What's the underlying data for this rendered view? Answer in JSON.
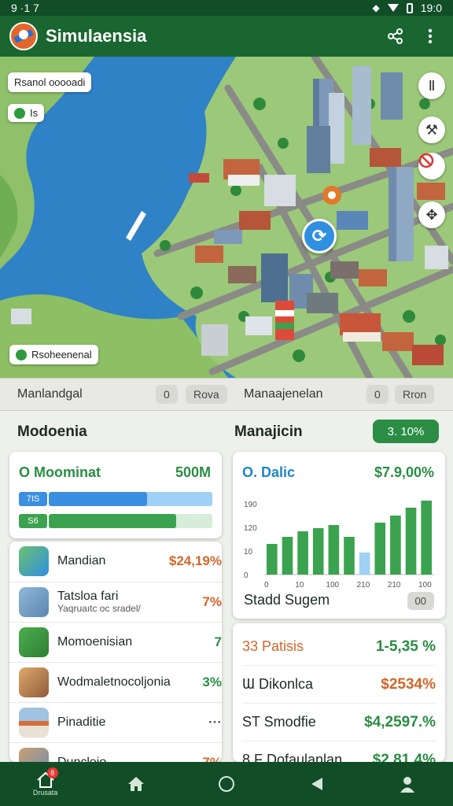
{
  "status_bar": {
    "time_left": "9 ·1 7",
    "time_right": "19:0"
  },
  "app": {
    "title": "Simulaensia"
  },
  "map": {
    "chip_top": "Rsanol ooooadi",
    "chip_small": "Is",
    "chip_bottom": "Rsoheenenal"
  },
  "toolbar": {
    "left_label": "Manlandgal",
    "left_pill_1": "0",
    "left_pill_2": "Rova",
    "right_label": "Manaajenelan",
    "right_pill_1": "0",
    "right_pill_2": "Rron"
  },
  "left_section": {
    "title": "Modoenia"
  },
  "right_section": {
    "title": "Manajicin",
    "badge": "3. 10%"
  },
  "metric_card": {
    "title": "O Moominat",
    "value": "500M",
    "bars": [
      {
        "tag": "7IS",
        "fill": 0.6,
        "color": "#3b8fe0",
        "rest_color": "#9fd0f5"
      },
      {
        "tag": "S6",
        "fill": 0.78,
        "color": "#3ba34f",
        "rest_color": "#d7ecd9"
      }
    ]
  },
  "list_items": [
    {
      "label": "Mandian",
      "sub": "",
      "value": "$24,19%",
      "value_color": "#d3662a",
      "icon": "avatar-icon"
    },
    {
      "label": "Tatsloa fari",
      "sub": "Yaqruaıtc oc sradel/",
      "value": "7%",
      "value_color": "#d3662a",
      "icon": "construction-icon"
    },
    {
      "label": "Momoenisian",
      "sub": "",
      "value": "7",
      "value_color": "#2a8d43",
      "icon": "worker-icon"
    },
    {
      "label": "Wodmaletnocoljonia",
      "sub": "",
      "value": "3%",
      "value_color": "#2a8d43",
      "icon": "citizen-icon"
    },
    {
      "label": "Pinaditie",
      "sub": "",
      "value": "···",
      "value_color": "#555555",
      "icon": "building-icon"
    },
    {
      "label": "Duncleio",
      "sub": "",
      "value": "7%",
      "value_color": "#d3662a",
      "icon": "city-icon"
    }
  ],
  "chart_card": {
    "title": "O. Dalic",
    "value": "$7.9,00%",
    "footer_label": "Stadd Sugem",
    "footer_pill": "00"
  },
  "chart_data": {
    "type": "bar",
    "title": "",
    "xlabel": "",
    "ylabel": "",
    "y_ticks": [
      "0",
      "10",
      "120",
      "190"
    ],
    "x_ticks": [
      "0",
      "10",
      "100",
      "210",
      "210",
      "100"
    ],
    "ylim": [
      0,
      200
    ],
    "values": [
      78,
      96,
      110,
      118,
      126,
      96,
      56,
      132,
      150,
      170,
      188
    ],
    "colors": [
      "#3ba34f",
      "#3ba34f",
      "#3ba34f",
      "#3ba34f",
      "#3ba34f",
      "#3ba34f",
      "#9fd0f5",
      "#3ba34f",
      "#3ba34f",
      "#3ba34f",
      "#3ba34f"
    ]
  },
  "stats_card": {
    "rows": [
      {
        "name": "33 Patisis",
        "name_color": "#d3662a",
        "value": "1-5,35 %",
        "value_color": "#2a8d43"
      },
      {
        "name": "Ɯ Dikonlca",
        "name_color": "#1d2a22",
        "value": "$2534%",
        "value_color": "#d3662a"
      },
      {
        "name": "ST Smodfie",
        "name_color": "#1d2a22",
        "value": "$4,2597.%",
        "value_color": "#2a8d43"
      },
      {
        "name": "8.F Dofaulanlan",
        "name_color": "#1d2a22",
        "value": "$2.81.4%",
        "value_color": "#2a8d43"
      }
    ]
  },
  "bottom_nav": {
    "badge": "8",
    "home_caption": "Drusata"
  }
}
